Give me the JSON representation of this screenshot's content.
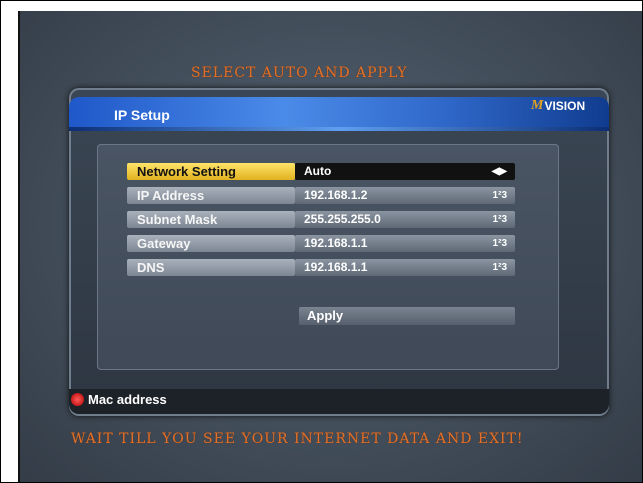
{
  "instructions": {
    "top": "SELECT AUTO AND APPLY",
    "bottom": "WAIT TILL YOU SEE YOUR INTERNET DATA AND EXIT!"
  },
  "window": {
    "title": "IP Setup",
    "brand": "VISION",
    "brand_mark": "M"
  },
  "settings": [
    {
      "label": "Network Setting",
      "value": "Auto",
      "icon": "left-right-arrows-icon"
    },
    {
      "label": "IP Address",
      "value": "192.168.1.2",
      "icon": "numeric-input-icon"
    },
    {
      "label": "Subnet Mask",
      "value": "255.255.255.0",
      "icon": "numeric-input-icon"
    },
    {
      "label": "Gateway",
      "value": "192.168.1.1",
      "icon": "numeric-input-icon"
    },
    {
      "label": "DNS",
      "value": "192.168.1.1",
      "icon": "numeric-input-icon"
    }
  ],
  "apply_button": "Apply",
  "footer": {
    "mac_label": "Mac address",
    "indicator_color": "#d00000"
  },
  "colors": {
    "instruction": "#e0702a",
    "selected_label": "#f4c92b",
    "title_bar": "#2f67c8"
  }
}
